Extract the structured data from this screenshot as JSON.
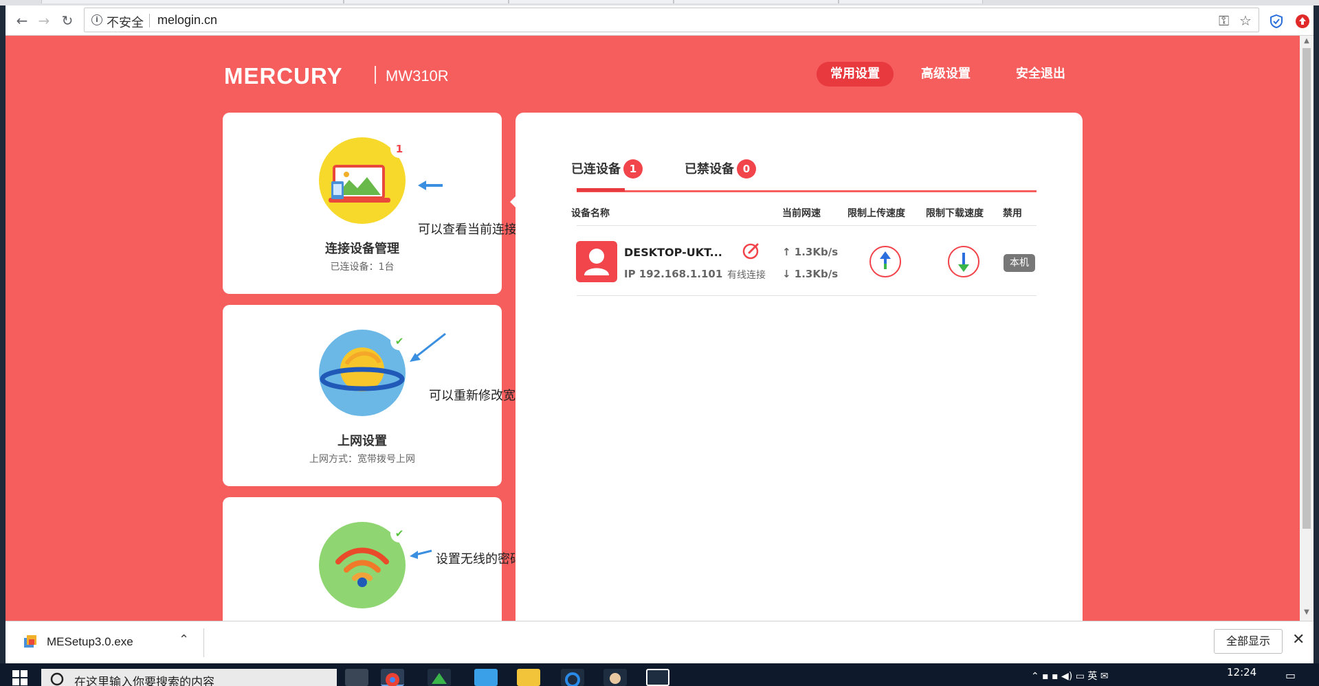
{
  "browser": {
    "security_label": "不安全",
    "url": "melogin.cn"
  },
  "router": {
    "brand": "MERCURY",
    "model": "MW310R",
    "nav": [
      "常用设置",
      "高级设置",
      "安全退出"
    ]
  },
  "cards": [
    {
      "title": "连接设备管理",
      "subtitle": "已连设备：1台",
      "badge": "1"
    },
    {
      "title": "上网设置",
      "subtitle": "上网方式：宽带拨号上网",
      "badge": "✔"
    },
    {
      "title": "",
      "subtitle": "",
      "badge": "✔"
    }
  ],
  "panel": {
    "tabs": [
      {
        "label": "已连设备",
        "count": "1"
      },
      {
        "label": "已禁设备",
        "count": "0"
      }
    ],
    "columns": [
      "设备名称",
      "当前网速",
      "限制上传速度",
      "限制下载速度",
      "禁用"
    ],
    "devices": [
      {
        "name": "DESKTOP-UKT...",
        "ip": "IP 192.168.1.101",
        "connection": "有线连接",
        "upload": "↑ 1.3Kb/s",
        "download": "↓ 1.3Kb/s",
        "tag": "本机"
      }
    ]
  },
  "annotations": [
    "可以查看当前连接网络的设备",
    "可以重新修改宽带信息，比如新拉的网线",
    "设置无线的密码 名称"
  ],
  "download_bar": {
    "file": "MESetup3.0.exe",
    "show_all": "全部显示"
  },
  "taskbar": {
    "search_placeholder": "在这里输入你要搜索的内容",
    "clock": "12:24"
  },
  "colors": {
    "page_bg": "#f65d5d",
    "accent": "#e8393f",
    "badge": "#f2454b",
    "check": "#5ac33f"
  }
}
